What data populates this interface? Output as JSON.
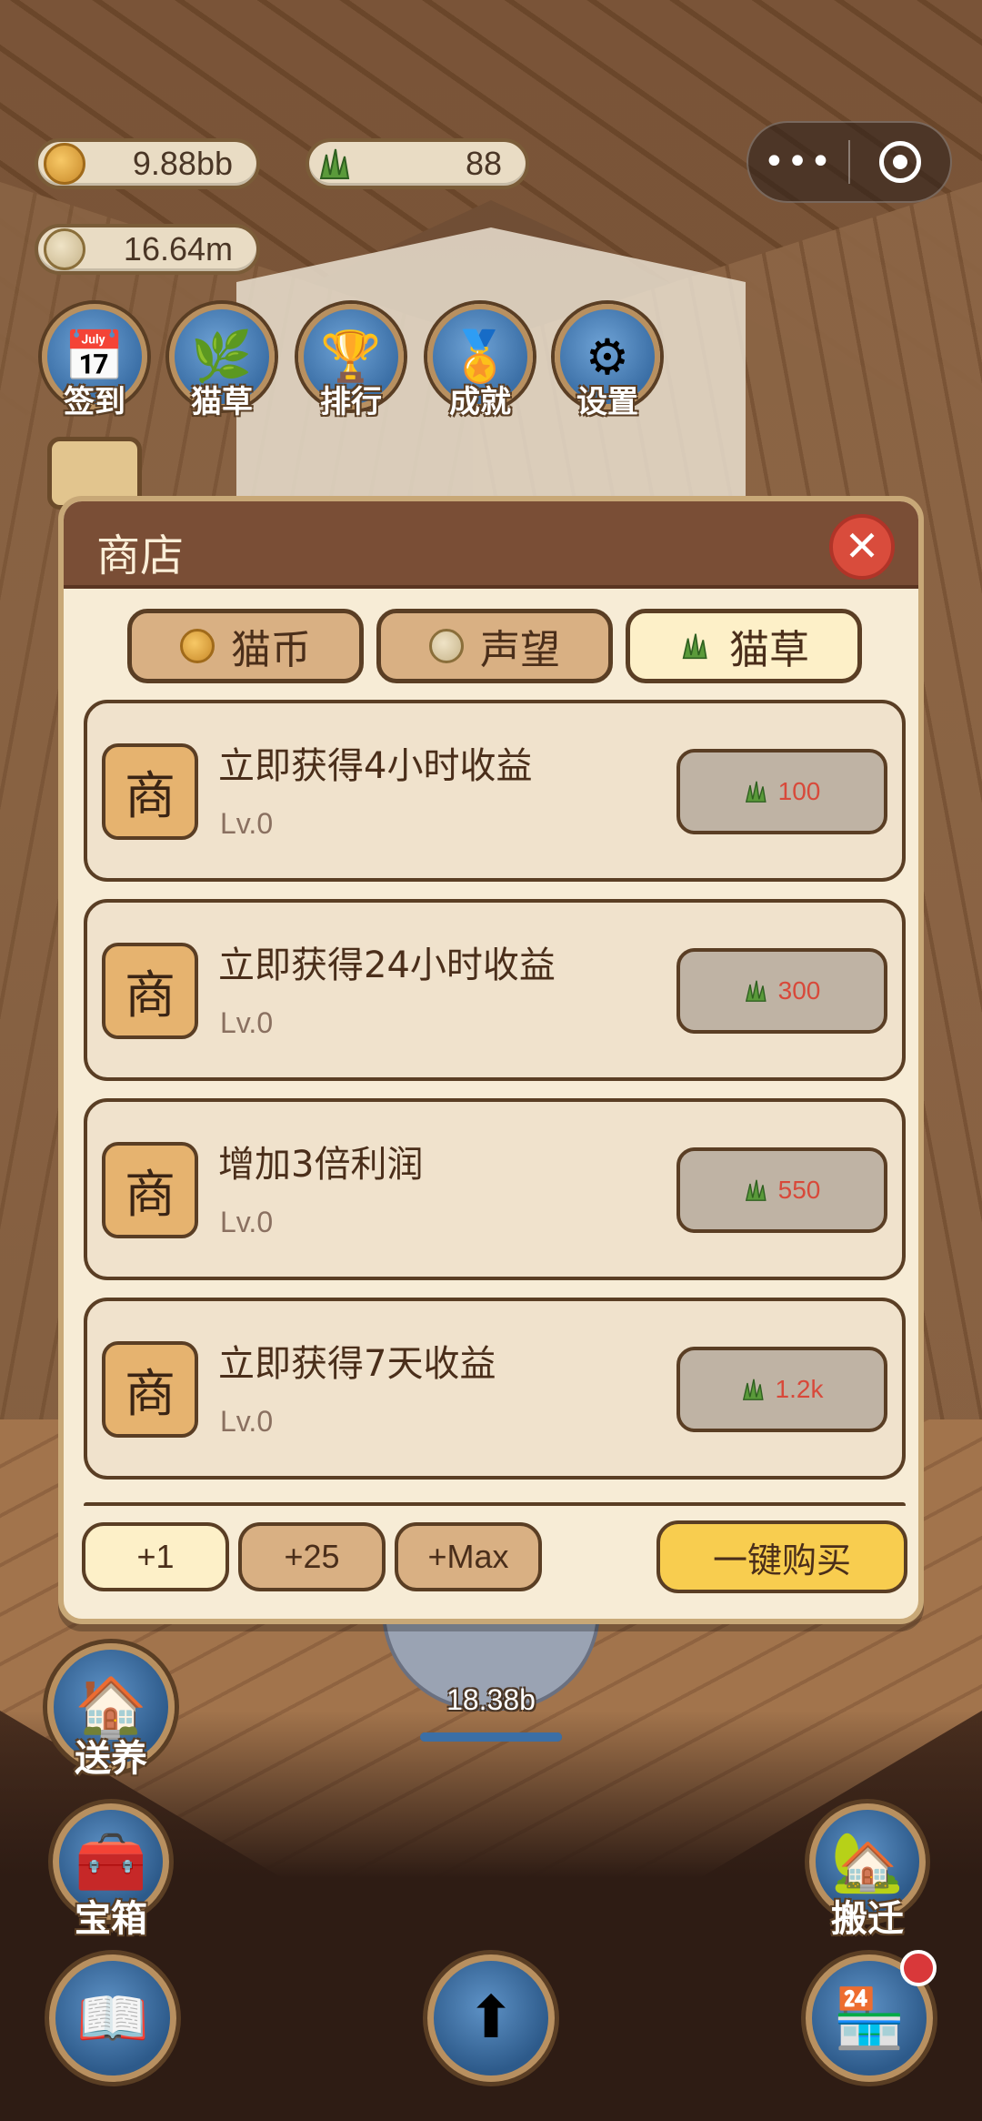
{
  "resources": {
    "coins": "9.88bb",
    "grass": "88",
    "prestige": "16.64m"
  },
  "capsule": {
    "more_icon": "more-dots-icon",
    "close_icon": "target-icon"
  },
  "menu": [
    {
      "label": "签到",
      "icon": "calendar-icon"
    },
    {
      "label": "猫草",
      "icon": "grass-icon"
    },
    {
      "label": "排行",
      "icon": "trophy-icon"
    },
    {
      "label": "成就",
      "icon": "cup-icon"
    },
    {
      "label": "设置",
      "icon": "gear-icon"
    }
  ],
  "shop": {
    "title": "商店",
    "close_symbol": "✕",
    "tabs": [
      {
        "label": "猫币",
        "icon": "coin-icon",
        "active": false
      },
      {
        "label": "声望",
        "icon": "laurel-icon",
        "active": false
      },
      {
        "label": "猫草",
        "icon": "grass-icon",
        "active": true
      }
    ],
    "badge_char": "商",
    "items": [
      {
        "name": "立即获得4小时收益",
        "level": "Lv.0",
        "price": "100"
      },
      {
        "name": "立即获得24小时收益",
        "level": "Lv.0",
        "price": "300"
      },
      {
        "name": "增加3倍利润",
        "level": "Lv.0",
        "price": "550"
      },
      {
        "name": "立即获得7天收益",
        "level": "Lv.0",
        "price": "1.2k"
      }
    ],
    "quantities": [
      "+1",
      "+25",
      "+Max"
    ],
    "buy_all": "一键购买"
  },
  "side_buttons": {
    "adopt": "送养",
    "chest": "宝箱",
    "move": "搬迁"
  },
  "cat_counter": "18.38b",
  "progress_fraction": 1.0,
  "colors": {
    "header": "#7a4e36",
    "panel": "#f7ecd6",
    "price": "#d8493a",
    "buy_all": "#f8cd4f"
  }
}
